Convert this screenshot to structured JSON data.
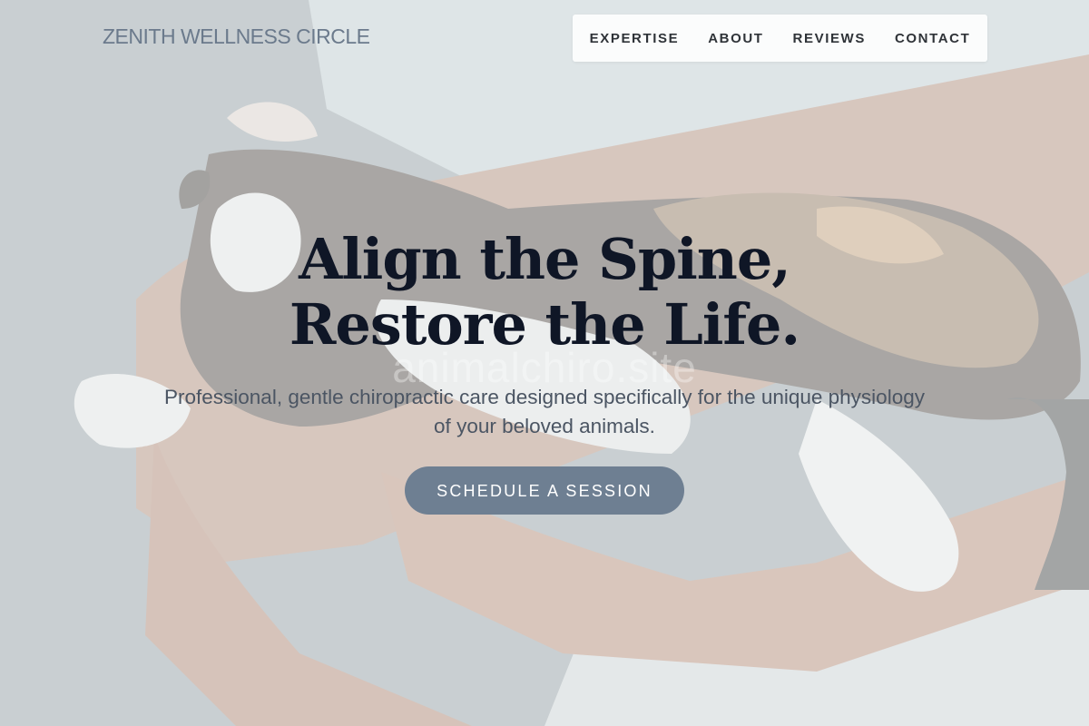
{
  "brand": {
    "name": "ZENITH WELLNESS CIRCLE"
  },
  "nav": {
    "items": [
      {
        "label": "EXPERTISE"
      },
      {
        "label": "ABOUT"
      },
      {
        "label": "REVIEWS"
      },
      {
        "label": "CONTACT"
      }
    ]
  },
  "hero": {
    "headline_line1": "Align the Spine,",
    "headline_line2": "Restore the Life.",
    "watermark": "animalchiro.site",
    "subheading": "Professional, gentle chiropractic care designed specifically for the unique physiology of your beloved animals.",
    "cta_label": "SCHEDULE A SESSION"
  },
  "colors": {
    "accent": "#6e7f92",
    "brand_text": "#6b7a8c",
    "headline": "#0f1626",
    "body_text": "#4b5563"
  }
}
